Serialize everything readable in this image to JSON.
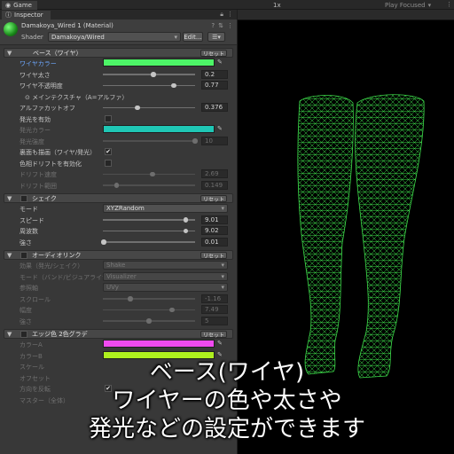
{
  "game_tab": {
    "label": "Game",
    "scale_label": "1x",
    "play_mode": "Play Focused"
  },
  "inspector": {
    "tab_label": "Inspector",
    "material_name": "Damakoya_Wired 1 (Material)",
    "shader_label": "Shader",
    "shader_value": "Damakoya/Wired",
    "edit_label": "Edit...",
    "reset_label": "リセット",
    "sections": {
      "base": {
        "title": "ベース（ワイヤ）",
        "wire_color": {
          "label": "ワイヤカラー",
          "color": "#4df567"
        },
        "wire_width": {
          "label": "ワイヤ太さ",
          "value": "0.2",
          "fraction": 0.55
        },
        "wire_alpha": {
          "label": "ワイヤ不透明度",
          "value": "0.77",
          "fraction": 0.77
        },
        "main_texture": {
          "label": "メインテクスチャ（A=アルファ）"
        },
        "alpha_cutoff": {
          "label": "アルファカットオフ",
          "value": "0.376",
          "fraction": 0.376
        },
        "emission_enable": {
          "label": "発光を有効"
        },
        "emission_color": {
          "label": "発光カラー",
          "color": "#1fc7b5"
        },
        "emission_strength": {
          "label": "発光強度",
          "value": "10",
          "fraction": 1.0
        },
        "double_sided": {
          "label": "裏面も描画（ワイヤ/発光）",
          "checked": "✔"
        },
        "hue_shift": {
          "label": "色相ドリフトを有効化"
        },
        "drift_speed": {
          "label": "ドリフト速度",
          "value": "2.69",
          "fraction": 0.54
        },
        "drift_range": {
          "label": "ドリフト範囲",
          "value": "0.149",
          "fraction": 0.15
        }
      },
      "shake": {
        "title": "シェイク",
        "mode": {
          "label": "モード",
          "value": "XYZRandom"
        },
        "speed": {
          "label": "スピード",
          "value": "9.01",
          "fraction": 0.9
        },
        "frequency": {
          "label": "周波数",
          "value": "9.02",
          "fraction": 0.9
        },
        "strength": {
          "label": "強さ",
          "value": "0.01",
          "fraction": 0.01
        }
      },
      "audio": {
        "title": "オーディオリンク",
        "effect": {
          "label": "効果（発光/シェイク）",
          "value": "Shake"
        },
        "mode": {
          "label": "モード（バンド/ビジュアライザ）",
          "value": "Visualizer"
        },
        "scroll_axis": {
          "label": "参照軸",
          "value": "UVy"
        },
        "scroll": {
          "label": "スクロール",
          "value": "-1.16",
          "fraction": 0.3
        },
        "scale": {
          "label": "幅度",
          "value": "7.49",
          "fraction": 0.75
        },
        "strength": {
          "label": "強さ",
          "value": "5",
          "fraction": 0.5
        }
      },
      "edge": {
        "title": "エッジ色 2色グラデ",
        "color_a": {
          "label": "カラーA",
          "color": "#f04af0"
        },
        "color_b": {
          "label": "カラーB",
          "color": "#aef01e"
        },
        "scale": {
          "label": "スケール"
        },
        "offset": {
          "label": "オフセット"
        },
        "reverse": {
          "label": "方向を反転",
          "checked": "✔"
        }
      },
      "master": {
        "label": "マスター（全体）"
      }
    }
  },
  "caption": {
    "line1": "ベース(ワイヤ)",
    "line2": "ワイヤーの色や太さや",
    "line3": "発光などの設定ができます"
  },
  "colors": {
    "wire_green": "#3ddc4a",
    "panel_bg": "#383838"
  }
}
